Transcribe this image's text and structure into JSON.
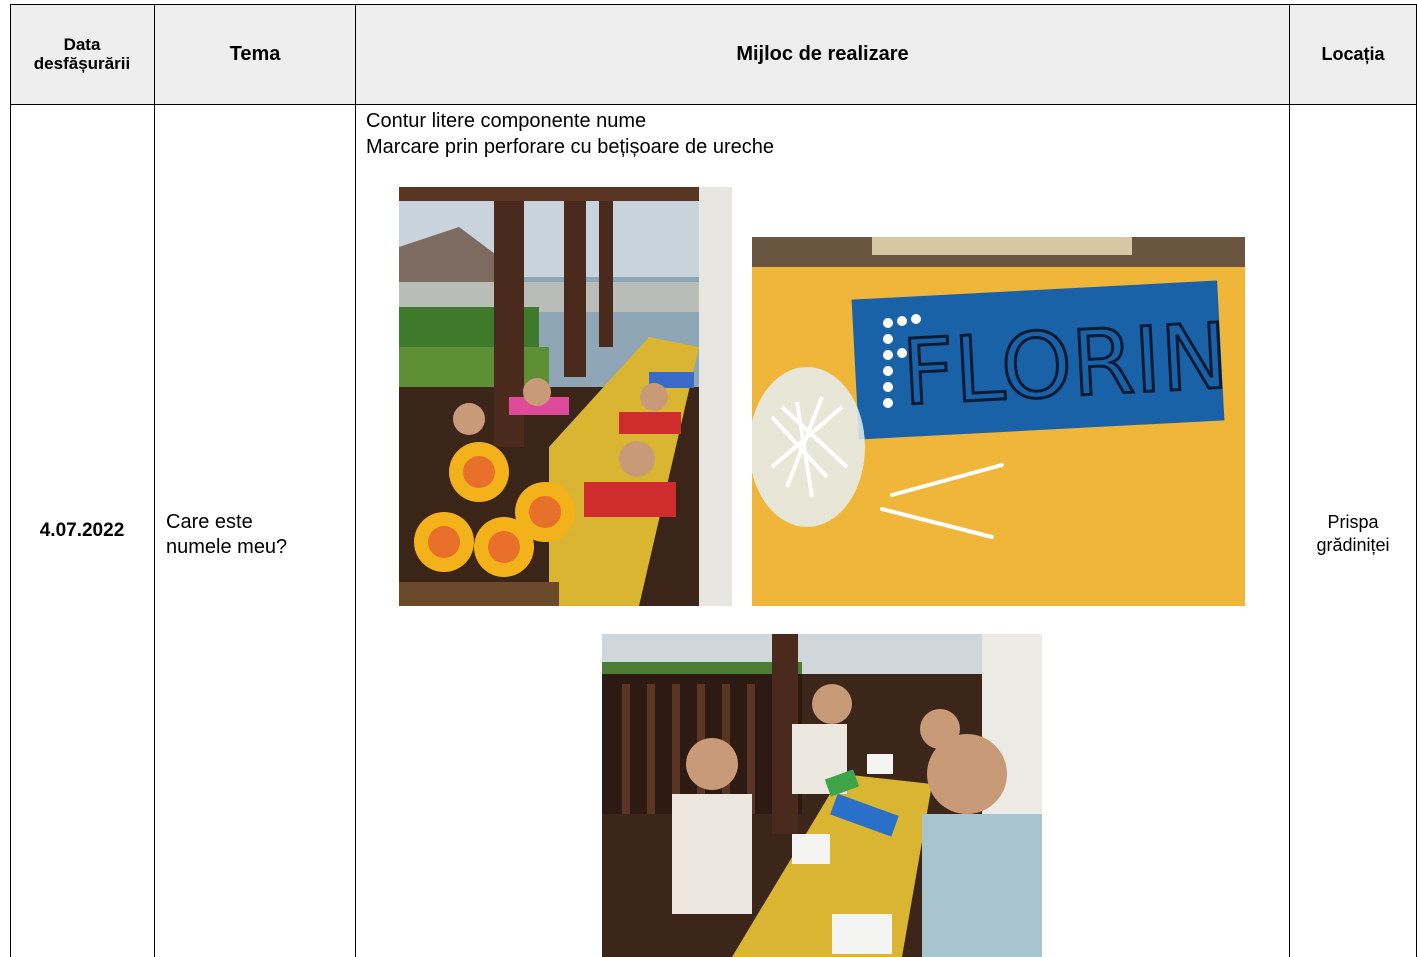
{
  "table": {
    "headers": {
      "date_line1": "Data",
      "date_line2": "desfășurării",
      "tema": "Tema",
      "mijloc": "Mijloc de realizare",
      "locatia": "Locația"
    },
    "row": {
      "date": "4.07.2022",
      "tema_line1": "Care este",
      "tema_line2": "numele meu?",
      "mijloc_line1": "Contur litere componente nume",
      "mijloc_line2": "Marcare prin perforare cu bețișoare de ureche",
      "loc_line1": "Prispa",
      "loc_line2": "grădiniței"
    }
  },
  "photos": {
    "name_card_text": "FLORIN"
  },
  "colors": {
    "header_bg": "#eeeeee",
    "grid": "#000000",
    "table_yellow": "#f2b233",
    "card_blue": "#1a62a8",
    "wood": "#4a2a1c"
  }
}
